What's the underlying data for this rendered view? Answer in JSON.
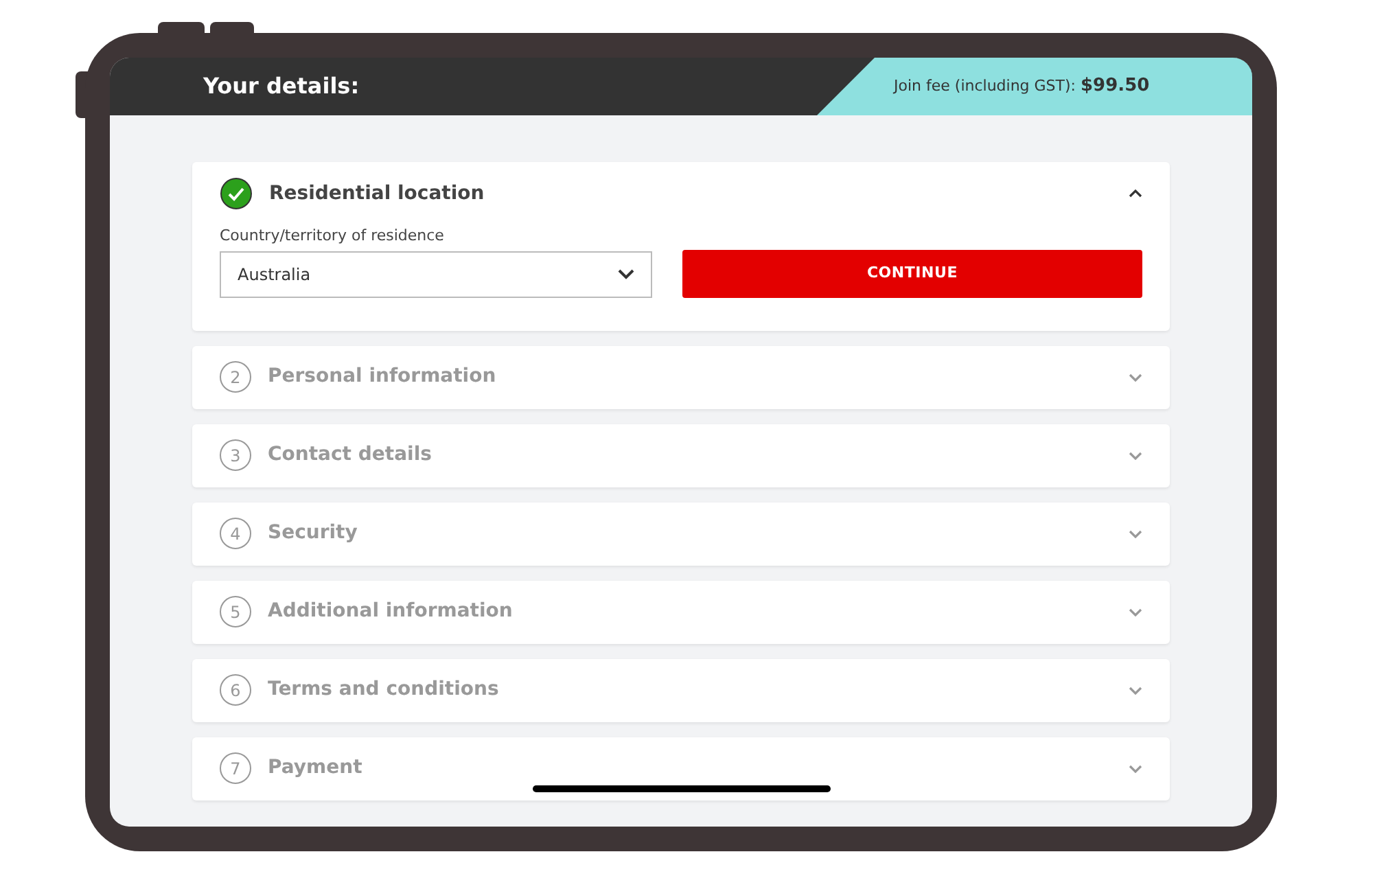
{
  "header": {
    "title": "Your details:",
    "fee": "Join fee (including GST): **$99.50**"
  },
  "steps": [
    {
      "title": "Residential location",
      "completed": true,
      "expanded": true,
      "field": {
        "label": "Country/territory of residence",
        "value": "Australia"
      },
      "button": "CONTINUE"
    },
    {
      "number": "2",
      "title": "Personal information",
      "completed": false,
      "expanded": false
    },
    {
      "number": "3",
      "title": "Contact details",
      "completed": false,
      "expanded": false
    },
    {
      "number": "4",
      "title": "Security",
      "completed": false,
      "expanded": false
    },
    {
      "number": "5",
      "title": "Additional information",
      "completed": false,
      "expanded": false
    },
    {
      "number": "6",
      "title": "Terms and conditions",
      "completed": false,
      "expanded": false
    },
    {
      "number": "7",
      "title": "Payment",
      "completed": false,
      "expanded": false
    }
  ]
}
